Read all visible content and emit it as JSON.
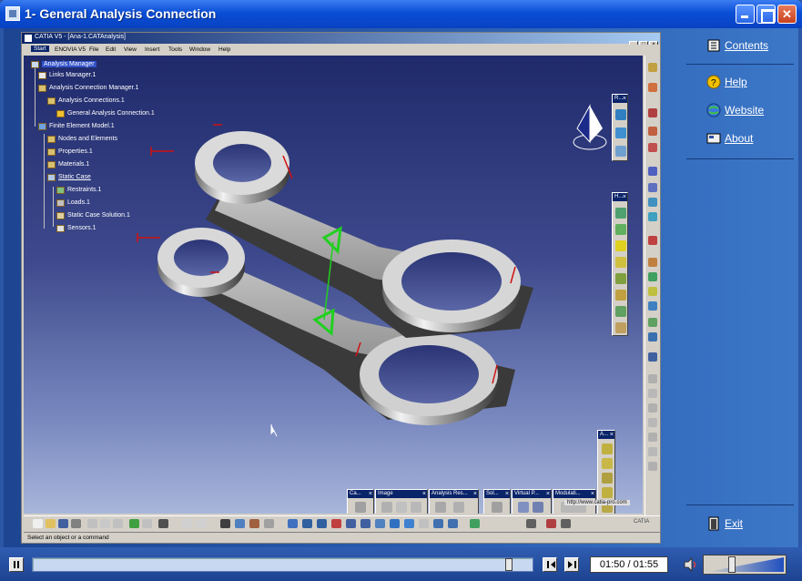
{
  "window": {
    "title": "1- General Analysis Connection"
  },
  "catia": {
    "title": "CATIA V5 - [Ana-1.CATAnalysis]",
    "menu": [
      "Start",
      "ENOVIA V5",
      "File",
      "Edit",
      "View",
      "Insert",
      "Tools",
      "Window",
      "Help"
    ],
    "tree": [
      "Analysis Manager",
      "Links Manager.1",
      "Analysis Connection Manager.1",
      "Analysis Connections.1",
      "General Analysis Connection.1",
      "Finite Element Model.1",
      "Nodes and Elements",
      "Properties.1",
      "Materials.1",
      "Static Case",
      "Restraints.1",
      "Loads.1",
      "Static Case Solution.1",
      "Sensors.1"
    ],
    "toolbars": [
      "Ca...",
      "Image",
      "Analysis Res...",
      "Sol...",
      "Virtual P...",
      "Modulati..."
    ],
    "small_toolbars": [
      "R...",
      "H...",
      "A..."
    ],
    "status_text": "Select an object or a command",
    "url": "http://www.catia-pro.com",
    "logo": "CATIA"
  },
  "side": {
    "contents": "Contents",
    "help": "Help",
    "website": "Website",
    "about": "About",
    "exit": "Exit"
  },
  "player": {
    "time": "01:50 / 01:55",
    "progress": 0.96,
    "volume": 0.3
  },
  "colors": {
    "accent": "#0a4ed6",
    "panel": "#2c57a6"
  }
}
